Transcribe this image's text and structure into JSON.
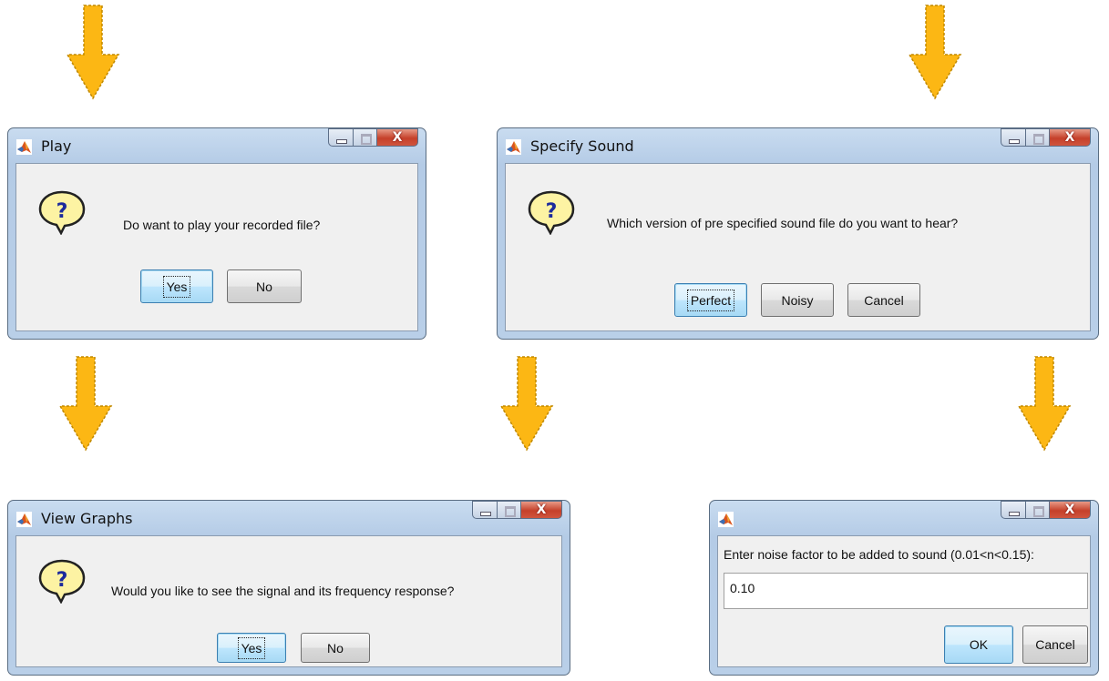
{
  "colors": {
    "arrow_fill": "#fcb714",
    "arrow_outline": "#c08800",
    "window_frame": "#b9cfe8",
    "close_button": "#c5402a",
    "dialog_body": "#f0f0f0"
  },
  "play_dialog": {
    "title": "Play",
    "message": "Do want to play your recorded file?",
    "yes_label": "Yes",
    "no_label": "No"
  },
  "specify_dialog": {
    "title": "Specify Sound",
    "message": "Which version of pre specified sound file do you want to hear?",
    "perfect_label": "Perfect",
    "noisy_label": "Noisy",
    "cancel_label": "Cancel"
  },
  "graphs_dialog": {
    "title": "View Graphs",
    "message": "Would you like to see the signal and its frequency response?",
    "yes_label": "Yes",
    "no_label": "No"
  },
  "noise_dialog": {
    "title": "",
    "prompt": "Enter noise factor to be added to sound (0.01<n<0.15):",
    "value": "0.10",
    "ok_label": "OK",
    "cancel_label": "Cancel"
  },
  "window_controls": {
    "close_glyph": "X"
  }
}
